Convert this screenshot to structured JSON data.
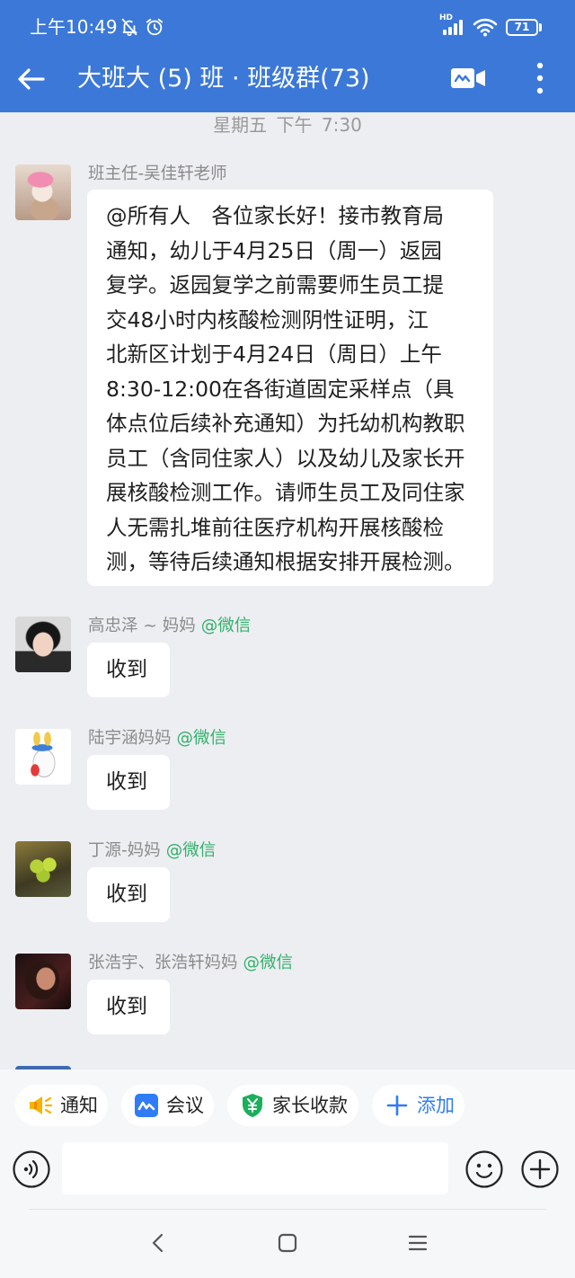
{
  "status_bar": {
    "time": "上午10:49",
    "network_label": "HD",
    "battery_level": "71",
    "icons": [
      "bell-off-icon",
      "alarm-icon",
      "signal-icon",
      "wifi-icon",
      "battery-icon"
    ]
  },
  "header": {
    "title": "大班大 (5) 班 · 班级群(73)",
    "icons": {
      "back": "back-arrow-icon",
      "video": "video-call-icon",
      "more": "more-vertical-icon"
    }
  },
  "chat": {
    "timestamp": "星期五 下午 7:30",
    "messages": [
      {
        "sender": "班主任-吴佳轩老师",
        "lines": [
          "@所有人　各位家长好！接市教育局",
          "通知，幼儿于4月25日（周一）返园",
          "复学。返园复学之前需要师生员工提",
          "交48小时内核酸检测阴性证明，江",
          "北新区计划于4月24日（周日）上午",
          "8:30-12:00在各街道固定采样点（具",
          "体点位后续补充通知）为托幼机构教职",
          "员工（含同住家人）以及幼儿及家长开",
          "展核酸检测工作。请师生员工及同住家",
          "人无需扎堆前往医疗机构开展核酸检",
          "测，等待后续通知根据安排开展检测。"
        ]
      },
      {
        "sender": "高忠泽 ~ 妈妈",
        "source": "@微信",
        "text": "收到"
      },
      {
        "sender": "陆宇涵妈妈",
        "source": "@微信",
        "text": "收到"
      },
      {
        "sender": "丁源-妈妈",
        "source": "@微信",
        "text": "收到"
      },
      {
        "sender": "张浩宇、张浩轩妈妈",
        "source": "@微信",
        "text": "收到"
      }
    ]
  },
  "quick_actions": [
    {
      "label": "通知",
      "icon": "megaphone-icon"
    },
    {
      "label": "会议",
      "icon": "meeting-icon"
    },
    {
      "label": "家长收款",
      "icon": "payment-shield-icon"
    },
    {
      "label": "添加",
      "icon": "plus-icon"
    }
  ],
  "composer": {
    "icons": [
      "voice-input-icon",
      "emoji-icon",
      "plus-circle-icon"
    ]
  },
  "nav_bar": {
    "icons": [
      "nav-back-icon",
      "nav-home-icon",
      "nav-recents-icon"
    ]
  },
  "colors": {
    "header": "#3b78d8",
    "chat_background": "#edeef2",
    "bubble": "#ffffff",
    "sender_name": "#8b8b8b",
    "source_tag": "#31b16a",
    "accent_blue": "#2f7cf6",
    "notify_yellow": "#f5b400",
    "pay_green": "#19b05a"
  }
}
